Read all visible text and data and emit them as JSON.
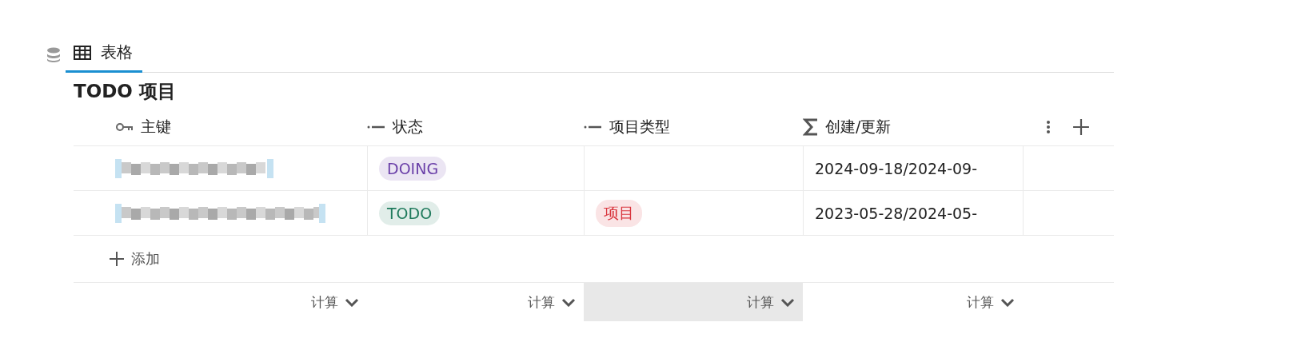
{
  "tabs": [
    {
      "label": "表格",
      "selected": true
    }
  ],
  "table": {
    "title": "TODO 项目",
    "columns": [
      {
        "label": "主键",
        "kind": "key"
      },
      {
        "label": "状态",
        "kind": "select"
      },
      {
        "label": "项目类型",
        "kind": "select"
      },
      {
        "label": "创建/更新",
        "kind": "formula"
      }
    ],
    "rows": [
      {
        "cells": [
          {
            "kind": "blurred"
          },
          {
            "kind": "tag",
            "text": "DOING",
            "color": "#6a3fa8"
          },
          {
            "kind": "empty"
          },
          {
            "kind": "text",
            "text": "2024-09-18/2024-09-"
          }
        ]
      },
      {
        "cells": [
          {
            "kind": "blurred"
          },
          {
            "kind": "tag",
            "text": "TODO",
            "color": "#1f7a5c"
          },
          {
            "kind": "tag",
            "text": "项目",
            "color": "#d9363e"
          },
          {
            "kind": "text",
            "text": "2023-05-28/2024-05-"
          }
        ]
      }
    ],
    "add_label": "添加",
    "footer": [
      {
        "label": "计算",
        "highlighted": false
      },
      {
        "label": "计算",
        "highlighted": false
      },
      {
        "label": "计算",
        "highlighted": true
      },
      {
        "label": "计算",
        "highlighted": false
      }
    ]
  }
}
